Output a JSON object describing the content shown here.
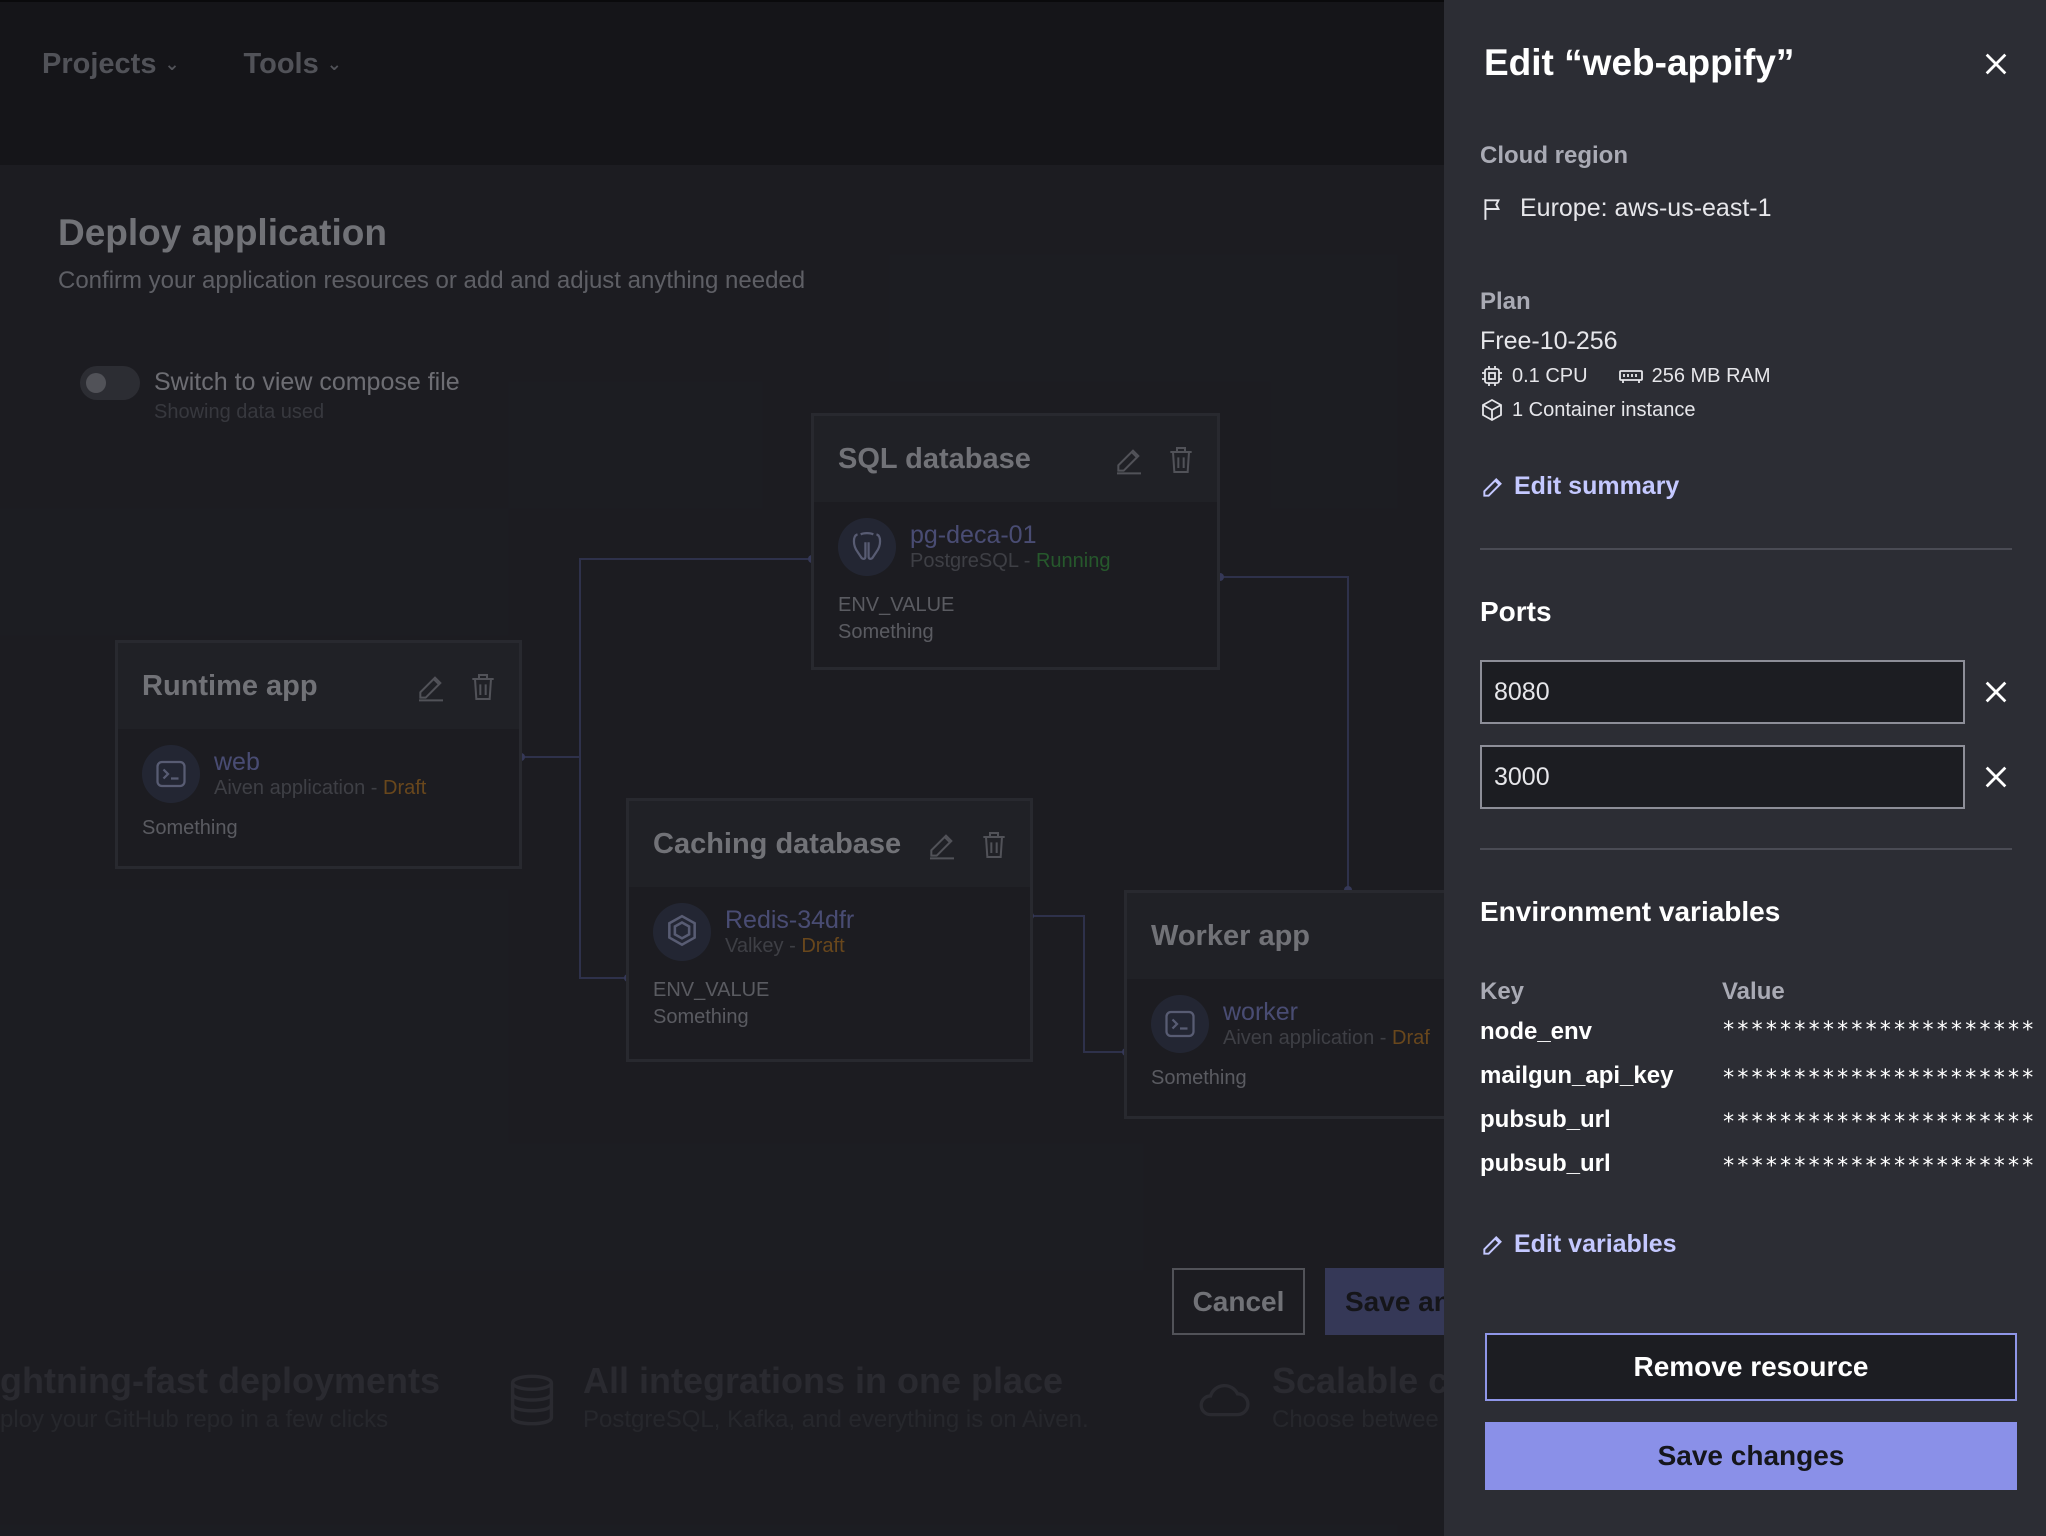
{
  "topnav": {
    "projects": "Projects",
    "tools": "Tools"
  },
  "page": {
    "title": "Deploy application",
    "subtitle": "Confirm your application resources or add and adjust anything needed",
    "toggle_label": "Switch to view compose file",
    "toggle_sub": "Showing data used"
  },
  "cards": {
    "sql": {
      "title": "SQL database",
      "name": "pg-deca-01",
      "type": "PostgreSQL",
      "status": "Running",
      "env_key": "ENV_VALUE",
      "env_val": "Something"
    },
    "runtime": {
      "title": "Runtime app",
      "name": "web",
      "type": "Aiven application",
      "status": "Draft",
      "note": "Something"
    },
    "caching": {
      "title": "Caching database",
      "name": "Redis-34dfr",
      "type": "Valkey",
      "status": "Draft",
      "env_key": "ENV_VALUE",
      "env_val": "Something"
    },
    "worker": {
      "title": "Worker app",
      "name": "worker",
      "type": "Aiven application",
      "status": "Draf",
      "note": "Something"
    },
    "sep": " - "
  },
  "actions": {
    "cancel": "Cancel",
    "save": "Save an"
  },
  "features": [
    {
      "title": "ghtning-fast deployments",
      "sub": "ploy your GitHub repo in a few clicks"
    },
    {
      "title": "All integrations in one place",
      "sub": "PostgreSQL, Kafka, and everything is on Aiven."
    },
    {
      "title": "Scalable c",
      "sub": "Choose betwee"
    }
  ],
  "drawer": {
    "title": "Edit “web-appify”",
    "cloud_region_label": "Cloud region",
    "cloud_region": "Europe: aws-us-east-1",
    "plan_label": "Plan",
    "plan": "Free-10-256",
    "cpu": "0.1 CPU",
    "ram": "256 MB RAM",
    "containers": "1 Container instance",
    "edit_summary": "Edit summary",
    "ports_title": "Ports",
    "ports": [
      "8080",
      "3000"
    ],
    "env_title": "Environment variables",
    "env_key_header": "Key",
    "env_value_header": "Value",
    "env": [
      {
        "key": "node_env",
        "value": "**********************"
      },
      {
        "key": "mailgun_api_key",
        "value": "**********************"
      },
      {
        "key": "pubsub_url",
        "value": "**********************"
      },
      {
        "key": "pubsub_url",
        "value": "**********************"
      }
    ],
    "edit_variables": "Edit variables",
    "remove_resource": "Remove resource",
    "save_changes": "Save changes"
  },
  "colors": {
    "accent": "#8a90e8",
    "link": "#c4c8ff",
    "running": "#3f9a47",
    "draft": "#b87a2b"
  }
}
